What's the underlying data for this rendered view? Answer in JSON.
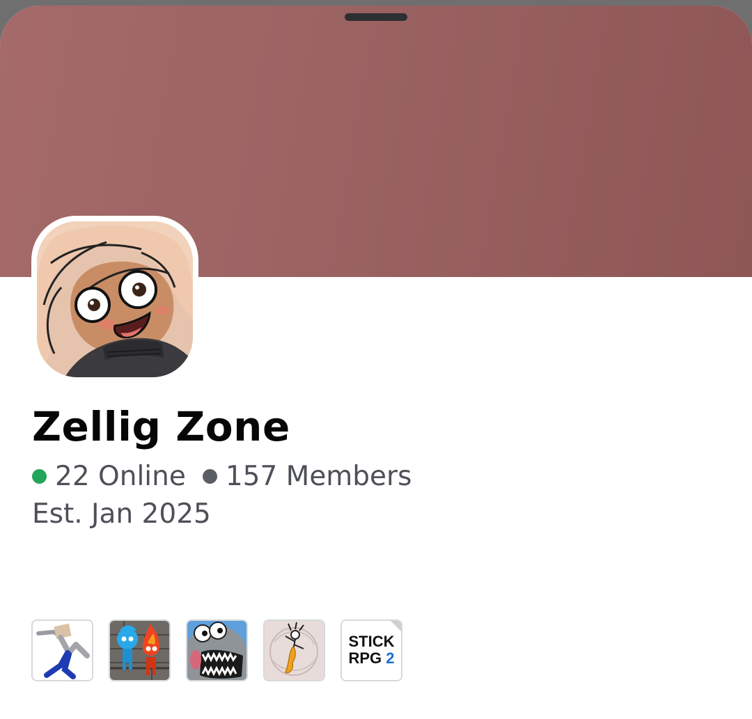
{
  "server": {
    "name": "Zellig Zone",
    "online": "22 Online",
    "members": "157 Members",
    "established": "Est. Jan 2025",
    "banner_color": "#9a6362",
    "online_color": "#23a55a",
    "members_color": "#5c5e66"
  },
  "avatar": {
    "icon": "cartoon-girl-avatar"
  },
  "games": [
    {
      "icon": "ragdoll-game-icon"
    },
    {
      "icon": "fireboy-watergirl-icon"
    },
    {
      "icon": "cartoon-monster-icon"
    },
    {
      "icon": "stick-figure-game-icon"
    },
    {
      "icon": "stick-rpg-2-icon",
      "label_line1": "STICK",
      "label_line2": "RPG",
      "label_number": "2"
    }
  ]
}
